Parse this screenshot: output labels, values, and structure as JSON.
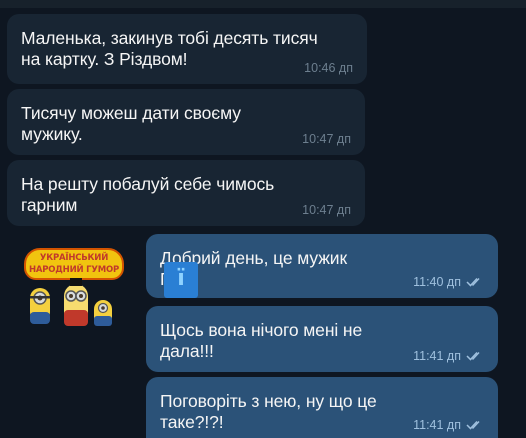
{
  "messages": [
    {
      "text": "Маленька, закинув тобі десять тисяч\nна картку. З Різдвом!",
      "time": "10:46 дп"
    },
    {
      "text": "Тисячу можеш дати своєму\nмужику.",
      "time": "10:47 дп"
    },
    {
      "text": "На решту побалуй себе чимось\nгарним",
      "time": "10:47 дп"
    },
    {
      "text": "Добрий день, це мужик\nГ     ї",
      "time": "11:40 дп"
    },
    {
      "text": "Щось вона нічого мені не\nдала!!!",
      "time": "11:41 дп"
    },
    {
      "text": "Поговоріть з нею, ну що це\nтаке?!?!",
      "time": "11:41 дп"
    }
  ],
  "sticker": {
    "line1": "УКРАЇНСЬКИЙ",
    "line2": "НАРОДНИЙ ГУМОР"
  },
  "badge": {
    "text": "ї"
  },
  "colors": {
    "background": "#0e1621",
    "incoming_bubble": "#182533",
    "outgoing_bubble": "#2b5278",
    "read_ticks": "#9fc0de"
  },
  "icons": [
    "double-check-icon",
    "minion-sticker"
  ]
}
